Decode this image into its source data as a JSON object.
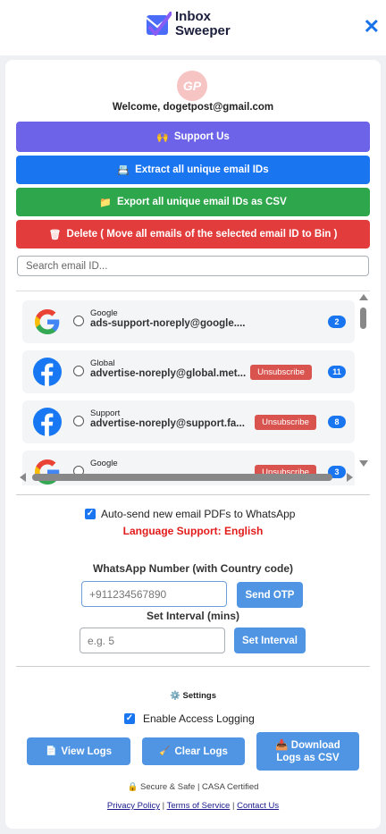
{
  "app": {
    "name_line1": "Inbox",
    "name_line2": "Sweeper",
    "logo_icon": "check-envelope-icon",
    "close_icon": "close-icon"
  },
  "profile": {
    "avatar_text": "GP",
    "welcome": "Welcome, dogetpost@gmail.com"
  },
  "actions": {
    "support": {
      "icon": "🙌",
      "label": "Support Us"
    },
    "extract": {
      "icon": "📇",
      "label": "Extract all unique email IDs"
    },
    "export": {
      "icon": "📁",
      "label": "Export all unique email IDs as CSV"
    },
    "delete": {
      "icon": "🗑",
      "label": "Delete ( Move all emails of the selected email ID to Bin )"
    }
  },
  "search": {
    "placeholder": "Search email ID..."
  },
  "senders": [
    {
      "logo": "google-logo",
      "name": "Google",
      "email": "ads-support-noreply@google....",
      "unsubscribe": "",
      "count": "2"
    },
    {
      "logo": "facebook-logo",
      "name": "Global",
      "email": "advertise-noreply@global.met...",
      "unsubscribe": "Unsubscribe",
      "count": "11"
    },
    {
      "logo": "facebook-logo",
      "name": "Support",
      "email": "advertise-noreply@support.fa...",
      "unsubscribe": "Unsubscribe",
      "count": "8"
    },
    {
      "logo": "google-logo",
      "name": "Google",
      "email": "",
      "unsubscribe": "Unsubscribe",
      "count": "3"
    }
  ],
  "whatsapp": {
    "auto_send_label": "Auto-send new email PDFs to WhatsApp",
    "auto_send_checked": true,
    "language_support": "Language Support: English",
    "number_label": "WhatsApp Number (with Country code)",
    "number_placeholder": "+911234567890",
    "send_otp": "Send OTP",
    "interval_label": "Set Interval (mins)",
    "interval_placeholder": "e.g. 5",
    "set_interval": "Set Interval"
  },
  "settings": {
    "icon": "⚙️",
    "title": "Settings",
    "access_logging_label": "Enable Access Logging",
    "access_logging_checked": true,
    "view_logs": {
      "icon": "📄",
      "label": "View Logs"
    },
    "clear_logs": {
      "icon": "🧹",
      "label": "Clear Logs"
    },
    "download_logs": {
      "icon": "📥",
      "label_line1": "Download",
      "label_line2": "Logs as CSV"
    }
  },
  "footer": {
    "secure_icon": "🔒",
    "secure_text": "Secure & Safe | CASA Certified",
    "privacy": "Privacy Policy",
    "sep1": " | ",
    "terms": "Terms of Service",
    "sep2": " | ",
    "contact": "Contact Us"
  },
  "colors": {
    "support": "#6c63e8",
    "extract": "#1a75f0",
    "export": "#2ea64b",
    "delete": "#e23c3c",
    "secondary": "#4f95e3",
    "language": "#e31b1b"
  }
}
